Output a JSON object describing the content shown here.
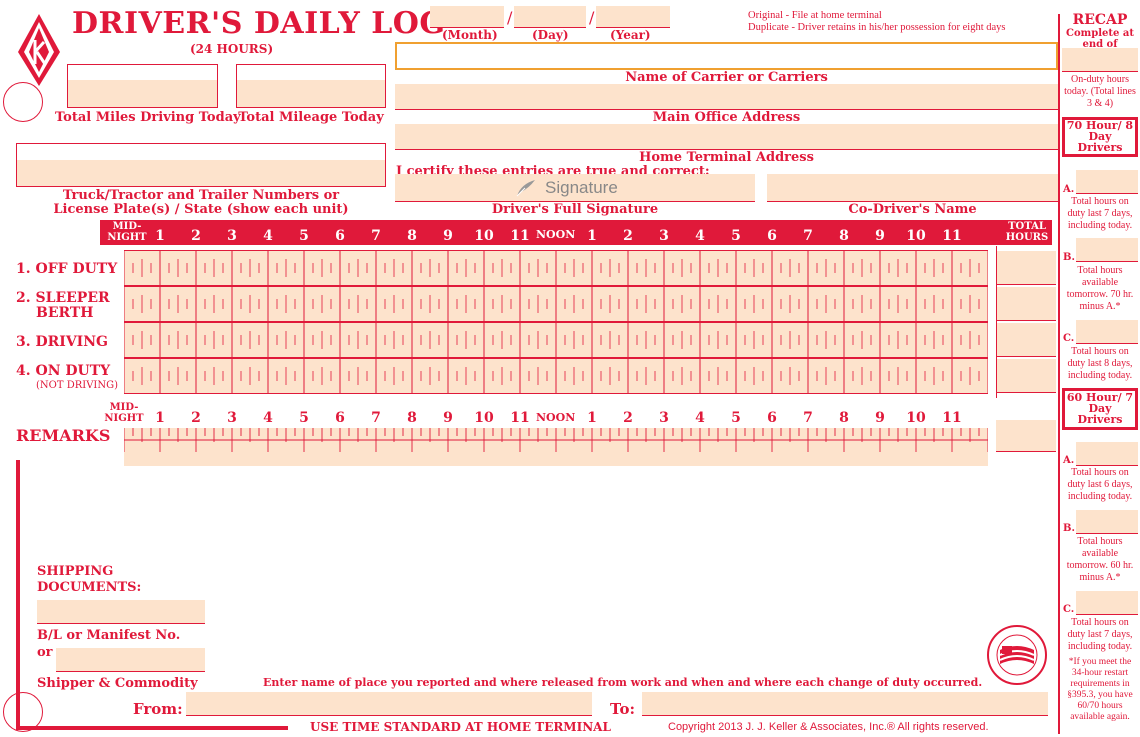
{
  "header": {
    "title": "DRIVER'S DAILY LOG",
    "subtitle": "(24 HOURS)",
    "date_labels": {
      "month": "(Month)",
      "day": "(Day)",
      "year": "(Year)"
    },
    "copies_line1": "Original - File at home terminal",
    "copies_line2": "Duplicate - Driver retains in his/her possession for eight days"
  },
  "fields": {
    "total_miles_driving": "Total Miles Driving Today",
    "total_mileage": "Total Mileage Today",
    "carrier_name": "Name of Carrier or Carriers",
    "main_office": "Main Office Address",
    "home_terminal": "Home Terminal Address",
    "certify": "I certify these entries are true and correct:",
    "signature_placeholder": "Signature",
    "driver_signature": "Driver's Full Signature",
    "co_driver": "Co-Driver's Name",
    "truck_label_1": "Truck/Tractor and Trailer Numbers or",
    "truck_label_2": "License Plate(s) / State (show each unit)"
  },
  "grid": {
    "midnight_1": "MID-",
    "midnight_2": "NIGHT",
    "noon": "NOON",
    "total_hours_1": "TOTAL",
    "total_hours_2": "HOURS",
    "hours_am": [
      "1",
      "2",
      "3",
      "4",
      "5",
      "6",
      "7",
      "8",
      "9",
      "10",
      "11"
    ],
    "hours_pm": [
      "1",
      "2",
      "3",
      "4",
      "5",
      "6",
      "7",
      "8",
      "9",
      "10",
      "11"
    ],
    "rows": [
      {
        "num": "1.",
        "label": "OFF DUTY",
        "sub": ""
      },
      {
        "num": "2.",
        "label": "SLEEPER",
        "sub": "BERTH"
      },
      {
        "num": "3.",
        "label": "DRIVING",
        "sub": ""
      },
      {
        "num": "4.",
        "label": "ON DUTY",
        "sub": "(NOT DRIVING)"
      }
    ],
    "remarks": "REMARKS"
  },
  "bottom": {
    "shipping_1": "SHIPPING",
    "shipping_2": "DOCUMENTS:",
    "bl": "B/L or Manifest No.",
    "or": "or",
    "shipper": "Shipper & Commodity",
    "instruction": "Enter name of place you reported and where released from work and when and where each change of duty occurred.",
    "from": "From:",
    "to": "To:",
    "time_standard": "USE TIME STANDARD AT HOME TERMINAL",
    "copyright": "Copyright 2013 J. J. Keller & Associates, Inc.® All rights reserved."
  },
  "recap": {
    "title": "RECAP",
    "sub": "Complete at end of workday.",
    "on_duty_today": "On-duty hours today. (Total lines 3 & 4)",
    "box70": "70 Hour/ 8 Day Drivers",
    "a70": "Total hours on duty last 7 days, including today.",
    "b70": "Total hours available tomorrow. 70 hr. minus A.*",
    "c70": "Total hours on duty last 8 days, including today.",
    "box60": "60 Hour/ 7 Day Drivers",
    "a60": "Total hours on duty last 6 days, including today.",
    "b60": "Total hours available tomorrow. 60 hr. minus A.*",
    "c60": "Total hours on duty last 7 days, including today.",
    "footnote": "*If you meet the 34-hour restart requirements in §395.3, you have 60/70 hours available again.",
    "letters": [
      "A.",
      "B.",
      "C."
    ]
  },
  "seal": {
    "text1": "MADE WITH PRIDE",
    "text2": "IN THE U.S.A."
  }
}
